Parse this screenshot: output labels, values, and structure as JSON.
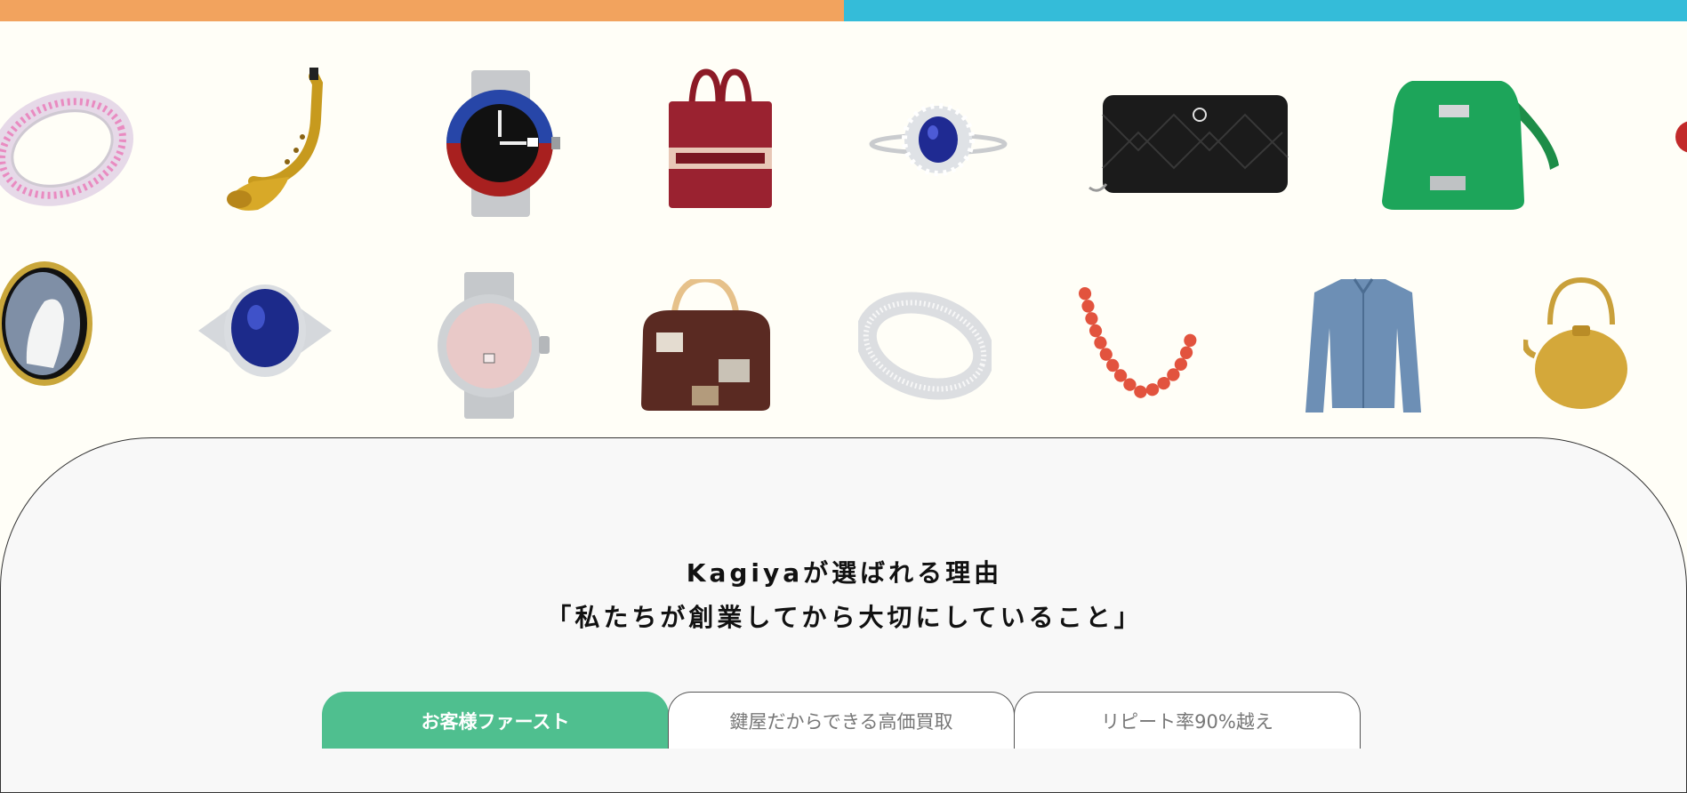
{
  "colors": {
    "bar_orange": "#f2a35e",
    "bar_blue": "#34bcd9",
    "tab_active": "#4fbf8f",
    "page_bg": "#fffef7"
  },
  "gallery": {
    "row1": [
      {
        "icon": "pink-diamond-eternity-ring"
      },
      {
        "icon": "gold-saxophone"
      },
      {
        "icon": "rolex-gmt-watch"
      },
      {
        "icon": "dior-book-tote-bag"
      },
      {
        "icon": "sapphire-diamond-ring"
      },
      {
        "icon": "chanel-black-wallet"
      },
      {
        "icon": "hermes-green-bag"
      },
      {
        "icon": "red-coral-brooch"
      }
    ],
    "row2": [
      {
        "icon": "cameo-brooch"
      },
      {
        "icon": "sapphire-cocktail-ring"
      },
      {
        "icon": "cartier-pink-watch"
      },
      {
        "icon": "louis-vuitton-speedy-bag"
      },
      {
        "icon": "diamond-band-ring"
      },
      {
        "icon": "coral-bead-necklace"
      },
      {
        "icon": "denim-jacket"
      },
      {
        "icon": "gold-kettle"
      }
    ]
  },
  "reasons": {
    "title": "Kagiyaが選ばれる理由",
    "subtitle": "「私たちが創業してから大切にしていること」"
  },
  "tabs": [
    {
      "label": "お客様ファースト",
      "active": true
    },
    {
      "label": "鍵屋だからできる高価買取",
      "active": false
    },
    {
      "label": "リピート率90%越え",
      "active": false
    }
  ]
}
